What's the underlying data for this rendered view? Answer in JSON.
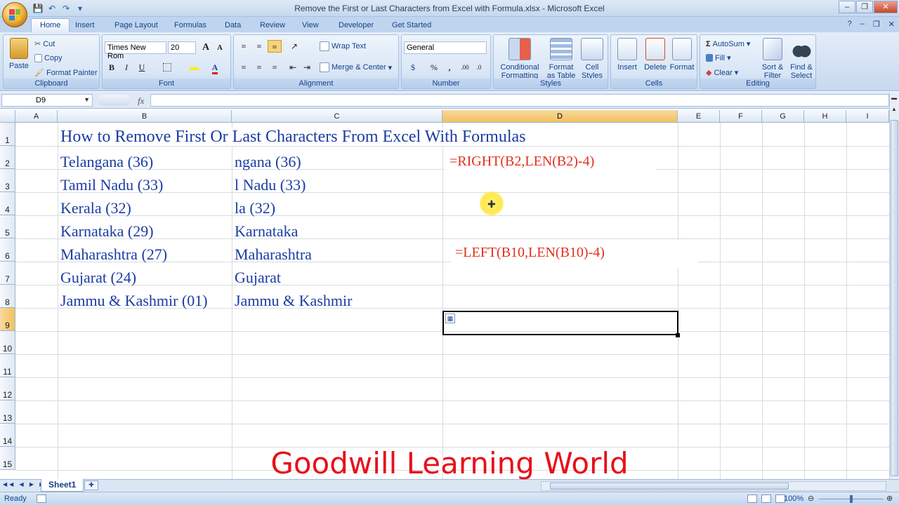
{
  "window": {
    "title": "Remove the First or Last Characters from Excel with Formula.xlsx - Microsoft Excel",
    "minimize": "–",
    "restore": "❐",
    "close": "✕"
  },
  "qat": {
    "save": "💾",
    "undo": "↶",
    "redo": "↷",
    "customize": "▾"
  },
  "tabs": [
    "Home",
    "Insert",
    "Page Layout",
    "Formulas",
    "Data",
    "Review",
    "View",
    "Developer",
    "Get Started"
  ],
  "tabs_right": {
    "help": "?",
    "minimize": "–",
    "restore": "❐",
    "close": "✕"
  },
  "ribbon": {
    "clipboard": {
      "label": "Clipboard",
      "paste": "Paste",
      "cut": "Cut",
      "copy": "Copy",
      "format_painter": "Format Painter"
    },
    "font": {
      "label": "Font",
      "font_name": "Times New Rom",
      "font_size": "20",
      "bold": "B",
      "italic": "I",
      "underline": "U",
      "grow": "A",
      "shrink": "A"
    },
    "alignment": {
      "label": "Alignment",
      "wrap_text": "Wrap Text",
      "merge_center": "Merge & Center"
    },
    "number": {
      "label": "Number",
      "format": "General",
      "currency": "$",
      "percent": "%",
      "comma": ","
    },
    "styles": {
      "label": "Styles",
      "conditional": "Conditional Formatting",
      "format_table": "Format as Table",
      "cell_styles": "Cell Styles"
    },
    "cells": {
      "label": "Cells",
      "insert": "Insert",
      "delete": "Delete",
      "format": "Format"
    },
    "editing": {
      "label": "Editing",
      "autosum": "AutoSum",
      "fill": "Fill",
      "clear": "Clear",
      "sort_filter": "Sort & Filter",
      "find_select": "Find & Select"
    }
  },
  "formula_bar": {
    "name_box": "D9",
    "fx": "fx",
    "formula": ""
  },
  "columns": [
    "A",
    "B",
    "C",
    "D",
    "E",
    "F",
    "G",
    "H",
    "I"
  ],
  "rows": [
    "1",
    "2",
    "3",
    "4",
    "5",
    "6",
    "7",
    "8",
    "9",
    "10",
    "11",
    "12",
    "13",
    "14",
    "15"
  ],
  "cells": {
    "title": "How to Remove First Or Last Characters From Excel With Formulas",
    "b": [
      "Telangana (36)",
      "Tamil Nadu (33)",
      "Kerala (32)",
      "Karnataka (29)",
      "Maharashtra (27)",
      "Gujarat (24)",
      "Jammu & Kashmir (01)"
    ],
    "c": [
      "ngana (36)",
      "l Nadu (33)",
      "la (32)",
      "Karnataka",
      "Maharashtra",
      "Gujarat",
      "Jammu & Kashmir"
    ]
  },
  "formulas": {
    "right": "=RIGHT(B2,LEN(B2)-4)",
    "left": "=LEFT(B10,LEN(B10)-4)"
  },
  "sheet_tabs": [
    "Sheet1"
  ],
  "status": {
    "ready": "Ready",
    "zoom": "100%"
  },
  "watermark": "Goodwill Learning World",
  "colors": {
    "cell_text": "#1b3ca3",
    "formula_text": "#e0301e",
    "watermark": "#e8101a",
    "selected_header": "#f1c15f"
  }
}
